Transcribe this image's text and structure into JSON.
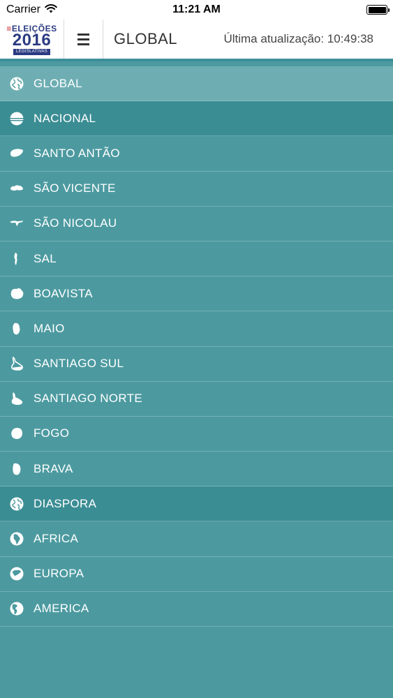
{
  "status_bar": {
    "carrier": "Carrier",
    "time": "11:21 AM"
  },
  "header": {
    "logo": {
      "top": "ELEIÇÕES",
      "year": "2016",
      "sub": "LEGISLATIVAS"
    },
    "title": "GLOBAL",
    "update_label": "Última atualização: 10:49:38"
  },
  "regions": [
    {
      "label": "GLOBAL",
      "icon": "globe-icon",
      "kind": "active"
    },
    {
      "label": "NACIONAL",
      "icon": "flag-icon",
      "kind": "section"
    },
    {
      "label": "SANTO ANTÃO",
      "icon": "island-santo-antao-icon",
      "kind": "item"
    },
    {
      "label": "SÃO VICENTE",
      "icon": "island-sao-vicente-icon",
      "kind": "item"
    },
    {
      "label": "SÃO NICOLAU",
      "icon": "island-sao-nicolau-icon",
      "kind": "item"
    },
    {
      "label": "SAL",
      "icon": "island-sal-icon",
      "kind": "item"
    },
    {
      "label": "BOAVISTA",
      "icon": "island-boavista-icon",
      "kind": "item"
    },
    {
      "label": "MAIO",
      "icon": "island-maio-icon",
      "kind": "item"
    },
    {
      "label": "SANTIAGO SUL",
      "icon": "island-santiago-sul-icon",
      "kind": "item"
    },
    {
      "label": "SANTIAGO NORTE",
      "icon": "island-santiago-norte-icon",
      "kind": "item"
    },
    {
      "label": "FOGO",
      "icon": "island-fogo-icon",
      "kind": "item"
    },
    {
      "label": "BRAVA",
      "icon": "island-brava-icon",
      "kind": "item"
    },
    {
      "label": "DIASPORA",
      "icon": "globe-icon",
      "kind": "section"
    },
    {
      "label": "AFRICA",
      "icon": "globe-africa-icon",
      "kind": "item"
    },
    {
      "label": "EUROPA",
      "icon": "globe-europe-icon",
      "kind": "item"
    },
    {
      "label": "AMERICA",
      "icon": "globe-america-icon",
      "kind": "item"
    }
  ]
}
